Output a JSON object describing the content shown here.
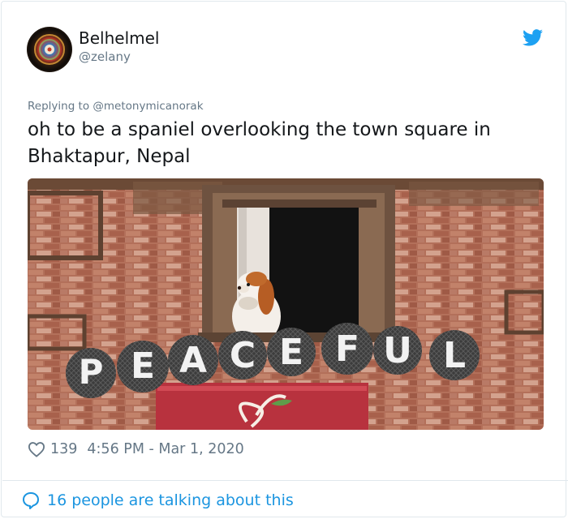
{
  "tweet": {
    "display_name": "Belhelmel",
    "handle": "@zelany",
    "replying_prefix": "Replying to",
    "replying_handle": "@metonymicanorak",
    "text": "oh to be a spaniel overlooking the town square in Bhaktapur, Nepal",
    "like_count": "139",
    "timestamp": "4:56 PM - Mar 1, 2020",
    "talking": "16 people are talking about this"
  },
  "media": {
    "sign_letters": [
      "P",
      "E",
      "A",
      "C",
      "E",
      "F",
      "U",
      "L"
    ]
  },
  "icons": {
    "brand": "twitter-bird-icon",
    "like": "heart-icon",
    "conversation": "speech-bubble-icon"
  },
  "colors": {
    "accent": "#1da1f2",
    "link": "#1b95e0",
    "secondary_text": "#657786",
    "border": "#e1e8ed"
  }
}
